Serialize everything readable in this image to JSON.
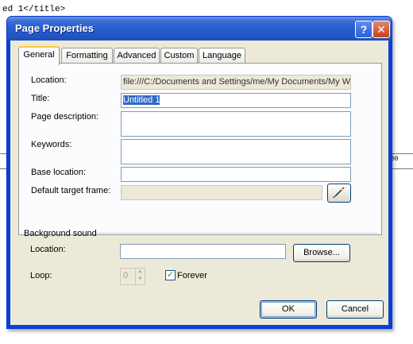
{
  "background": {
    "code_text": "ed 1</title>",
    "ruler_value": "00"
  },
  "dialog": {
    "title": "Page Properties",
    "help_label": "?",
    "close_label": "✕"
  },
  "tabs": [
    {
      "label": "General",
      "active": true
    },
    {
      "label": "Formatting",
      "active": false
    },
    {
      "label": "Advanced",
      "active": false
    },
    {
      "label": "Custom",
      "active": false
    },
    {
      "label": "Language",
      "active": false
    }
  ],
  "general": {
    "location_label": "Location:",
    "location_value": "file:///C:/Documents and Settings/me/My Documents/My Web",
    "title_label": "Title:",
    "title_value": "Untitled 1",
    "page_description_label": "Page description:",
    "page_description_value": "",
    "keywords_label": "Keywords:",
    "keywords_value": "",
    "base_location_label": "Base location:",
    "base_location_value": "",
    "default_target_frame_label": "Default target frame:",
    "default_target_frame_value": "",
    "picker_icon": "pencil-icon"
  },
  "background_sound": {
    "section_label": "Background sound",
    "location_label": "Location:",
    "location_value": "",
    "browse_label": "Browse...",
    "loop_label": "Loop:",
    "loop_value": "0",
    "forever_label": "Forever",
    "forever_checked": true
  },
  "buttons": {
    "ok_label": "OK",
    "cancel_label": "Cancel"
  },
  "colors": {
    "titlebar": "#2a5fd0",
    "dialog_face": "#ece9d8",
    "active_tab_accent": "#ffc83c",
    "selection": "#316ac5"
  }
}
